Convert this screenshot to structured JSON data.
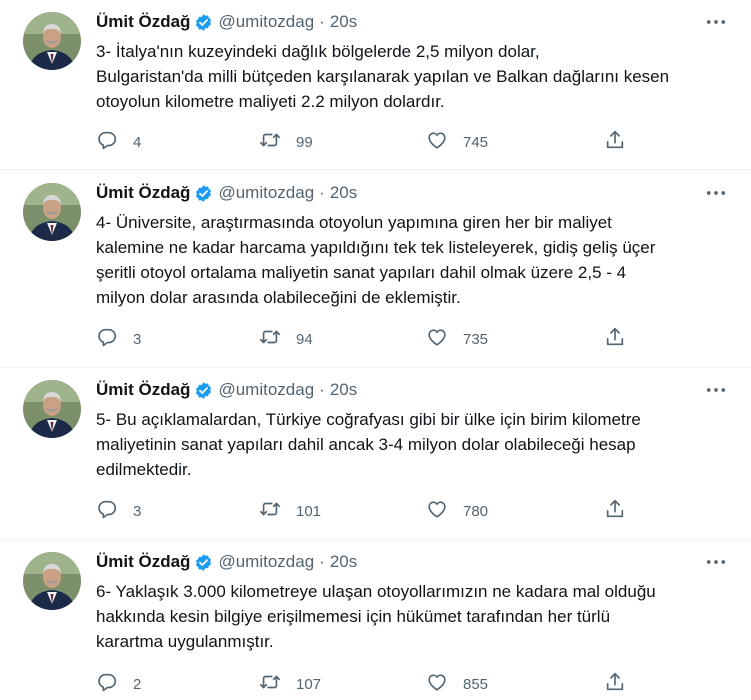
{
  "author": {
    "name": "Ümit Özdağ",
    "handle": "@umitozdag",
    "separator": "·",
    "time": "20s"
  },
  "icons": {
    "verified": "verified-badge-icon",
    "more": "more-icon",
    "reply": "reply-icon",
    "retweet": "retweet-icon",
    "like": "like-icon",
    "share": "share-icon"
  },
  "colors": {
    "verified": "#1d9bf0",
    "secondary_text": "#536471",
    "primary_text": "#0f1419"
  },
  "tweets": [
    {
      "lines": [
        "3- İtalya'nın kuzeyindeki dağlık bölgelerde 2,5 milyon dolar,",
        "Bulgaristan'da milli bütçeden karşılanarak yapılan ve Balkan dağlarını kesen",
        "otoyolun kilometre maliyeti 2.2 milyon dolardır."
      ],
      "replies": "4",
      "retweets": "99",
      "likes": "745"
    },
    {
      "lines": [
        "4- Üniversite, araştırmasında otoyolun yapımına giren her bir maliyet",
        "kalemine ne kadar harcama yapıldığını tek tek listeleyerek, gidiş geliş üçer",
        "şeritli otoyol ortalama maliyetin sanat yapıları dahil olmak üzere 2,5 - 4",
        "milyon dolar arasında olabileceğini de eklemiştir."
      ],
      "replies": "3",
      "retweets": "94",
      "likes": "735"
    },
    {
      "lines": [
        "5- Bu açıklamalardan, Türkiye coğrafyası gibi bir ülke için birim kilometre",
        "maliyetinin sanat yapıları dahil ancak 3-4 milyon dolar olabileceği hesap",
        "edilmektedir."
      ],
      "replies": "3",
      "retweets": "101",
      "likes": "780"
    },
    {
      "lines": [
        "6- Yaklaşık 3.000 kilometreye ulaşan otoyollarımızın ne kadara mal olduğu",
        "hakkında kesin bilgiye erişilmemesi için hükümet tarafından her türlü",
        "karartma uygulanmıştır."
      ],
      "replies": "2",
      "retweets": "107",
      "likes": "855"
    }
  ]
}
